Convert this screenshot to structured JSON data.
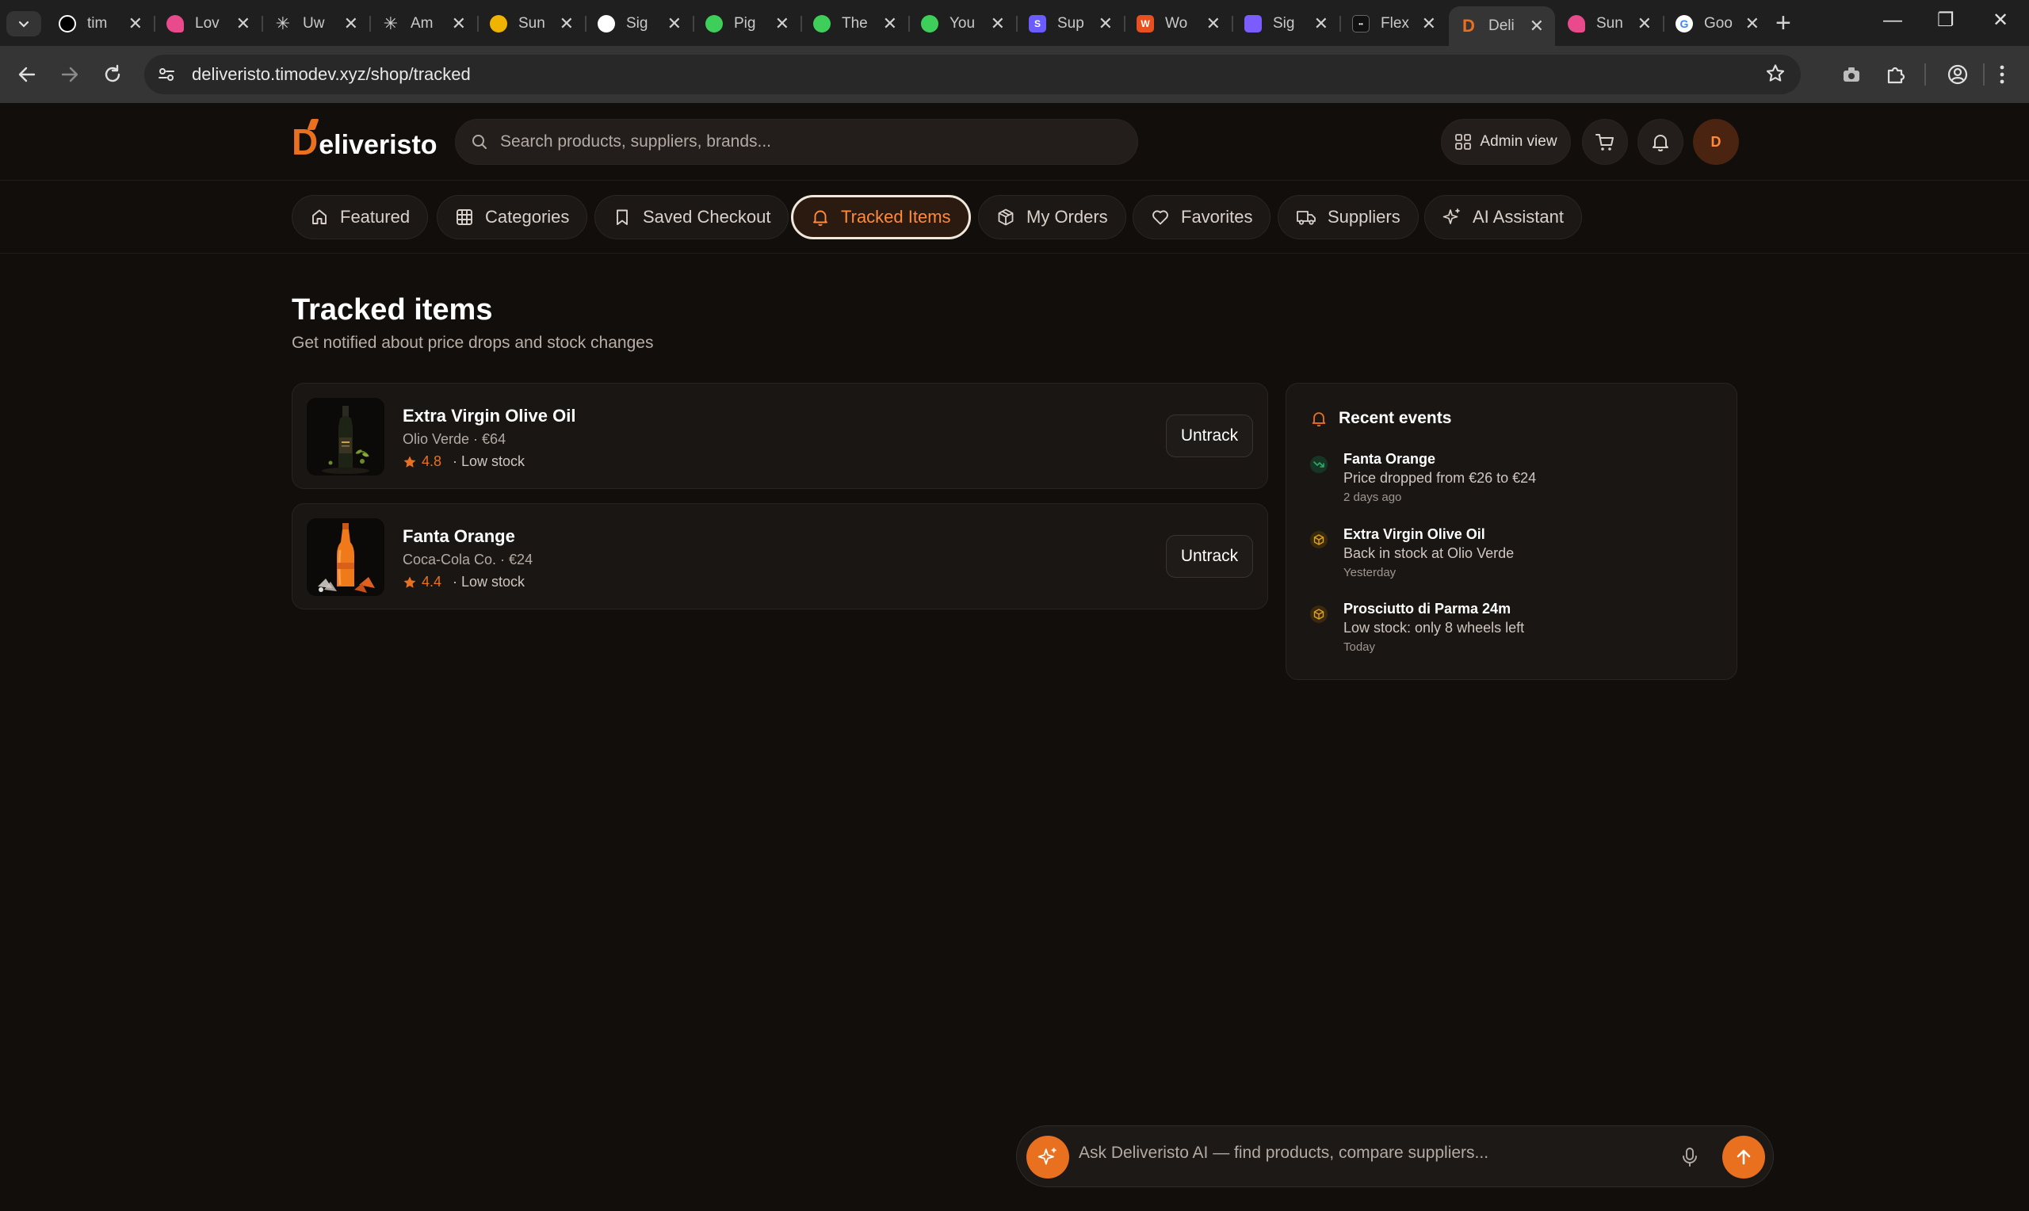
{
  "browser": {
    "tabs": [
      {
        "title": "tim",
        "fav_color": "#000000",
        "active": false
      },
      {
        "title": "Lov",
        "fav_color": "#e84a8c",
        "active": false
      },
      {
        "title": "Uw",
        "fav_color": "#cfcfcf",
        "active": false
      },
      {
        "title": "Am",
        "fav_color": "#cfcfcf",
        "active": false
      },
      {
        "title": "Sun",
        "fav_color": "#f0b400",
        "active": false
      },
      {
        "title": "Sig",
        "fav_color": "#ffffff",
        "active": false
      },
      {
        "title": "Pig",
        "fav_color": "#3ecf5a",
        "active": false
      },
      {
        "title": "The",
        "fav_color": "#3ecf5a",
        "active": false
      },
      {
        "title": "You",
        "fav_color": "#3ecf5a",
        "active": false
      },
      {
        "title": "Sup",
        "fav_color": "#6a5cff",
        "active": false
      },
      {
        "title": "Wo",
        "fav_color": "#e8501f",
        "active": false
      },
      {
        "title": "Sig",
        "fav_color": "#7a5cff",
        "active": false
      },
      {
        "title": "Flex",
        "fav_color": "#111111",
        "active": false
      },
      {
        "title": "Deli",
        "fav_color": "#e8701f",
        "active": true
      },
      {
        "title": "Sun",
        "fav_color": "#e84a8c",
        "active": false
      },
      {
        "title": "Goo",
        "fav_color": "#ffffff",
        "active": false
      }
    ],
    "url": "deliveristo.timodev.xyz/shop/tracked"
  },
  "header": {
    "logo_initial": "D",
    "logo_rest": "eliveristo",
    "search_placeholder": "Search products, suppliers, brands...",
    "admin_label": "Admin view",
    "avatar_initial": "D"
  },
  "nav": {
    "tabs": [
      {
        "label": "Featured",
        "icon": "home-icon"
      },
      {
        "label": "Categories",
        "icon": "grid-icon"
      },
      {
        "label": "Saved Checkout",
        "icon": "bookmark-icon"
      },
      {
        "label": "Tracked Items",
        "icon": "bell-icon",
        "active": true
      },
      {
        "label": "My Orders",
        "icon": "box-icon"
      },
      {
        "label": "Favorites",
        "icon": "heart-icon"
      },
      {
        "label": "Suppliers",
        "icon": "truck-icon"
      },
      {
        "label": "AI Assistant",
        "icon": "sparkle-icon"
      }
    ]
  },
  "page": {
    "title": "Tracked items",
    "subtitle": "Get notified about price drops and stock changes"
  },
  "items": [
    {
      "name": "Extra Virgin Olive Oil",
      "meta": "Olio Verde · €64",
      "rating": "4.8",
      "stock": "· Low stock",
      "action": "Untrack",
      "thumb_icon": "olive-oil-bottle-icon"
    },
    {
      "name": "Fanta Orange",
      "meta": "Coca-Cola Co. · €24",
      "rating": "4.4",
      "stock": "· Low stock",
      "action": "Untrack",
      "thumb_icon": "orange-soda-bottle-icon"
    }
  ],
  "events": {
    "title": "Recent events",
    "list": [
      {
        "name": "Fanta Orange",
        "desc": "Price dropped from €26 to €24",
        "time": "2 days ago",
        "icon": "trend-down-icon",
        "color": "#2fa86a"
      },
      {
        "name": "Extra Virgin Olive Oil",
        "desc": "Back in stock at Olio Verde",
        "time": "Yesterday",
        "icon": "package-icon",
        "color": "#e0a020"
      },
      {
        "name": "Prosciutto di Parma 24m",
        "desc": "Low stock: only 8 wheels left",
        "time": "Today",
        "icon": "package-icon",
        "color": "#e0a020"
      }
    ]
  },
  "ai": {
    "placeholder": "Ask Deliveristo AI — find products, compare suppliers..."
  },
  "colors": {
    "accent": "#e8701f",
    "background": "#110e0c",
    "card": "#1a1613"
  }
}
